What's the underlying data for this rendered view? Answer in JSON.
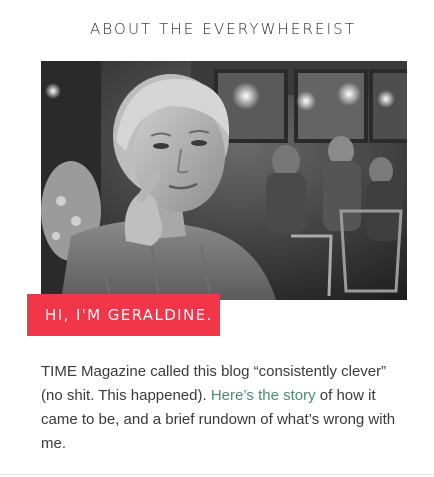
{
  "widget": {
    "title": "ABOUT THE EVERYWHEREIST",
    "badge_text": "HI, I'M GERALDINE.",
    "intro": {
      "part1": "TIME Magazine called this blog “consistently clever” (no shit. This happened). ",
      "link_text": "Here’s the story",
      "part2": " of how it came to be, and a brief rundown of what’s wrong with me."
    }
  },
  "colors": {
    "badge_background": "#f2364a",
    "link": "#4b8c6b",
    "text": "#3a3a3a"
  }
}
